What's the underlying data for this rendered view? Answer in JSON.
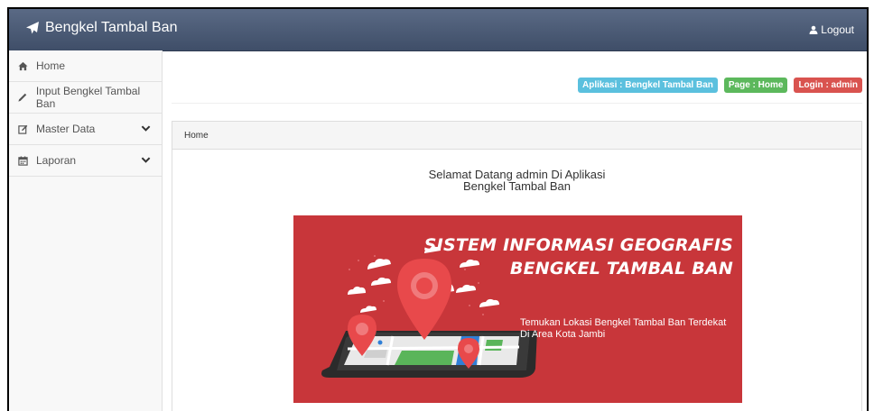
{
  "navbar": {
    "brand": "Bengkel Tambal Ban",
    "brand_icon": "paper-plane-icon",
    "logout_label": "Logout",
    "logout_icon": "user-icon"
  },
  "sidebar": {
    "items": [
      {
        "label": "Home",
        "icon": "home-icon"
      },
      {
        "label": "Input Bengkel Tambal Ban",
        "icon": "pencil-icon"
      },
      {
        "label": "Master Data",
        "icon": "edit-icon",
        "expandable": true
      },
      {
        "label": "Laporan",
        "icon": "calendar-icon",
        "expandable": true
      }
    ]
  },
  "labels": {
    "app": "Aplikasi : Bengkel Tambal Ban",
    "page": "Page : Home",
    "login": "Login : admin"
  },
  "colors": {
    "info": "#5bc0de",
    "success": "#5cb85c",
    "danger": "#d9534f",
    "navbar": "#4a5873",
    "banner": "#c8363a"
  },
  "panel": {
    "heading": "Home",
    "welcome_line1": "Selamat Datang admin Di Aplikasi",
    "welcome_line2": "Bengkel Tambal Ban"
  },
  "banner": {
    "title_line1": "SISTEM INFORMASI GEOGRAFIS",
    "title_line2": "BENGKEL TAMBAL BAN",
    "subtitle_line1": "Temukan Lokasi Bengkel Tambal Ban Terdekat",
    "subtitle_line2": "Di Area Kota Jambi"
  }
}
